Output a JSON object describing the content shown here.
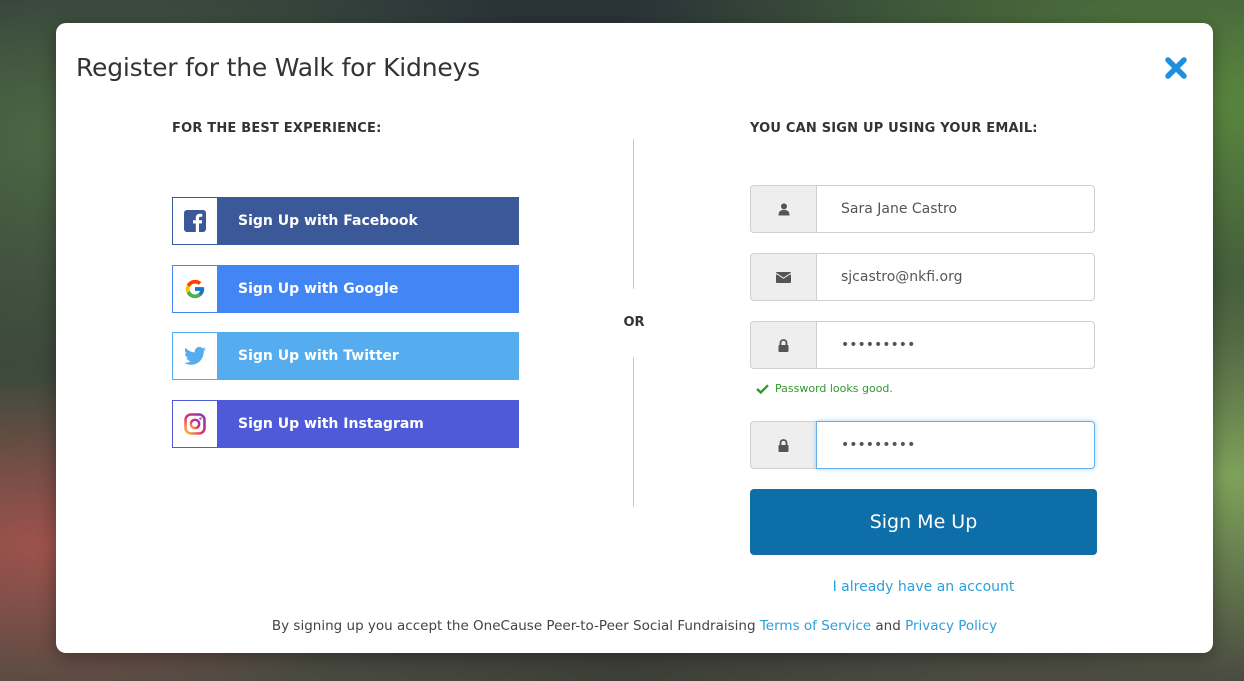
{
  "modal": {
    "title": "Register for the Walk for Kidneys",
    "close_icon": "close-icon"
  },
  "left": {
    "heading": "FOR THE BEST EXPERIENCE:",
    "buttons": [
      {
        "label": "Sign Up with Facebook",
        "icon": "facebook-icon",
        "color": "#3b5998"
      },
      {
        "label": "Sign Up with Google",
        "icon": "google-icon",
        "color": "#4285f4"
      },
      {
        "label": "Sign Up with Twitter",
        "icon": "twitter-icon",
        "color": "#55acee"
      },
      {
        "label": "Sign Up with Instagram",
        "icon": "instagram-icon",
        "color": "#4e5ad7"
      }
    ]
  },
  "divider": {
    "or_label": "OR"
  },
  "right": {
    "heading": "YOU CAN SIGN UP USING YOUR EMAIL:",
    "fields": {
      "name": {
        "value": "Sara Jane Castro",
        "icon": "user-icon"
      },
      "email": {
        "value": "sjcastro@nkfi.org",
        "icon": "envelope-icon"
      },
      "password": {
        "value": "passwords",
        "icon": "lock-icon"
      },
      "confirm_password": {
        "value": "passwords",
        "icon": "lock-icon"
      }
    },
    "password_status": "Password looks good.",
    "submit_label": "Sign Me Up",
    "login_link": "I already have an account"
  },
  "footer": {
    "prefix": "By signing up you accept the OneCause Peer-to-Peer Social Fundraising ",
    "terms_link": "Terms of Service",
    "and": " and ",
    "privacy_link": "Privacy Policy"
  },
  "colors": {
    "primary": "#0e6ea8",
    "link": "#2d9fd9",
    "success": "#2e9a2e",
    "close": "#1e90e0"
  }
}
